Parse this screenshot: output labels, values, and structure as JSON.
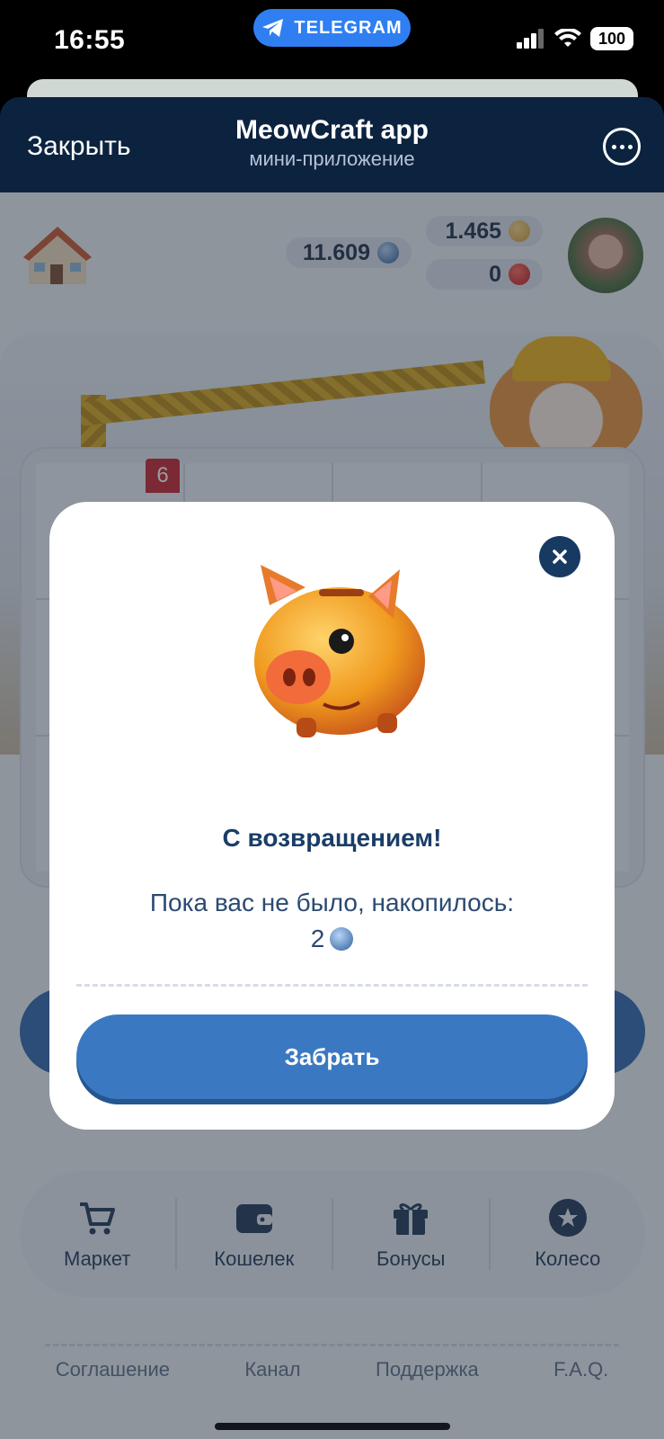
{
  "status_bar": {
    "time": "16:55",
    "telegram_label": "TELEGRAM",
    "battery": "100"
  },
  "header": {
    "close_label": "Закрыть",
    "title": "MeowCraft app",
    "subtitle": "мини-приложение"
  },
  "balances": {
    "paw_coins": "11.609",
    "cat_coins": "1.465",
    "tron": "0"
  },
  "board": {
    "badge_number": "6"
  },
  "modal": {
    "title": "С возвращением!",
    "message": "Пока вас не было, накопилось:",
    "amount": "2",
    "claim_label": "Забрать"
  },
  "nav": {
    "items": [
      {
        "label": "Маркет",
        "icon": "cart-icon"
      },
      {
        "label": "Кошелек",
        "icon": "wallet-icon"
      },
      {
        "label": "Бонусы",
        "icon": "gift-icon"
      },
      {
        "label": "Колесо",
        "icon": "star-circle-icon"
      }
    ]
  },
  "footer": {
    "links": [
      "Соглашение",
      "Канал",
      "Поддержка",
      "F.A.Q."
    ]
  },
  "colors": {
    "primary": "#3a79c2",
    "dark_navy": "#0c2340",
    "text_blue": "#1a3d68",
    "badge_red": "#c8232c"
  }
}
